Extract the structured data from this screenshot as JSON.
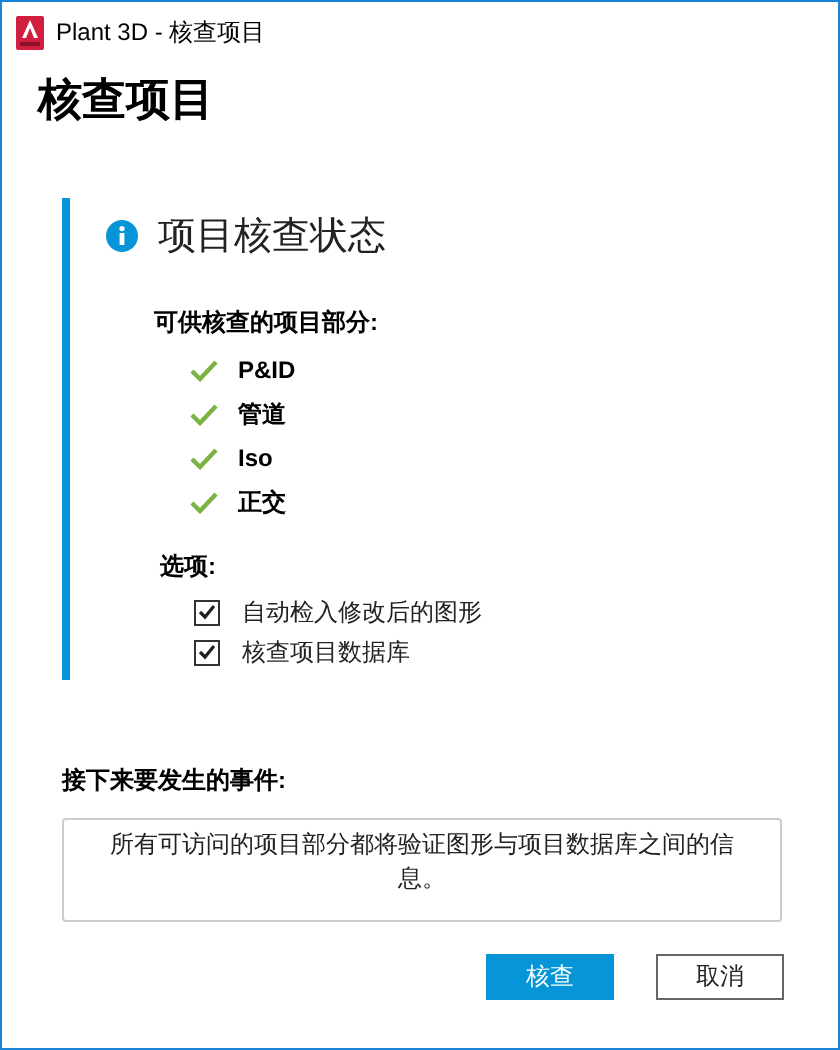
{
  "window": {
    "title": "Plant 3D - 核查项目"
  },
  "heading": "核查项目",
  "status": {
    "title": "项目核查状态",
    "parts_label": "可供核查的项目部分:",
    "parts": [
      {
        "label": "P&ID",
        "available": true
      },
      {
        "label": "管道",
        "available": true
      },
      {
        "label": "Iso",
        "available": true
      },
      {
        "label": "正交",
        "available": true
      }
    ],
    "options_label": "选项:",
    "options": [
      {
        "label": "自动检入修改后的图形",
        "checked": true
      },
      {
        "label": "核查项目数据库",
        "checked": true
      }
    ]
  },
  "next": {
    "label": "接下来要发生的事件:",
    "text": "所有可访问的项目部分都将验证图形与项目数据库之间的信息。"
  },
  "buttons": [
    {
      "label": "核查",
      "primary": true
    },
    {
      "label": "取消",
      "primary": false
    }
  ]
}
